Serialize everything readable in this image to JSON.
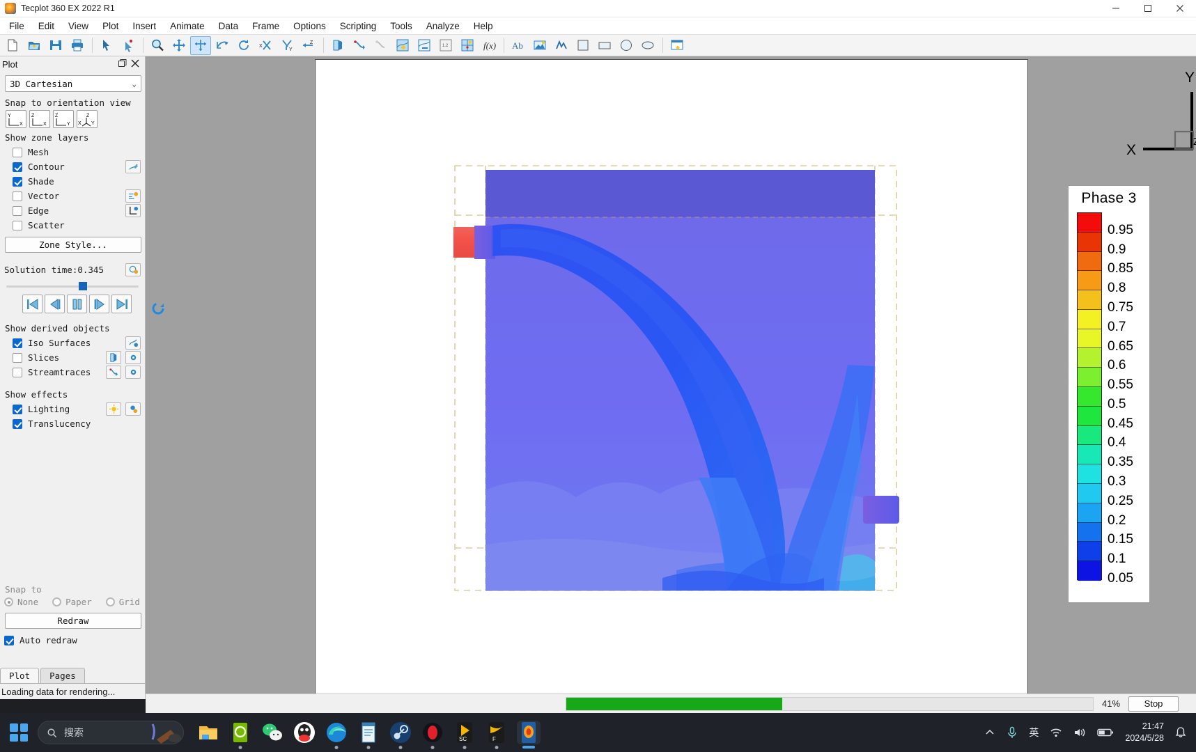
{
  "window": {
    "title": "Tecplot 360 EX 2022 R1",
    "app_icon": "tecplot-icon",
    "minimize_label": "Minimize",
    "maximize_label": "Maximize",
    "close_label": "Close"
  },
  "menubar": {
    "items": [
      {
        "label": "File"
      },
      {
        "label": "Edit"
      },
      {
        "label": "View"
      },
      {
        "label": "Plot"
      },
      {
        "label": "Insert"
      },
      {
        "label": "Animate"
      },
      {
        "label": "Data"
      },
      {
        "label": "Frame"
      },
      {
        "label": "Options"
      },
      {
        "label": "Scripting"
      },
      {
        "label": "Tools"
      },
      {
        "label": "Analyze"
      },
      {
        "label": "Help"
      }
    ]
  },
  "toolbar": {
    "buttons": [
      {
        "name": "new-layout-icon"
      },
      {
        "name": "open-layout-icon"
      },
      {
        "name": "save-layout-icon"
      },
      {
        "name": "print-icon"
      },
      {
        "name": "select-tool-icon"
      },
      {
        "name": "adjust-tool-icon"
      },
      {
        "name": "zoom-tool-icon"
      },
      {
        "name": "translate-tool-icon"
      },
      {
        "name": "rotate-spherical-icon"
      },
      {
        "name": "rotate-roller-icon"
      },
      {
        "name": "rotate-twist-icon"
      },
      {
        "name": "rotate-x-icon"
      },
      {
        "name": "rotate-y-icon"
      },
      {
        "name": "rotate-z-icon"
      },
      {
        "name": "slice-tool-icon"
      },
      {
        "name": "streamtrace-tool-icon"
      },
      {
        "name": "streamtrace-terminator-icon"
      },
      {
        "name": "contour-add-icon"
      },
      {
        "name": "contour-label-icon"
      },
      {
        "name": "value-label-icon"
      },
      {
        "name": "extract-points-icon"
      },
      {
        "name": "function-fx-icon"
      },
      {
        "name": "text-tool-icon"
      },
      {
        "name": "image-tool-icon"
      },
      {
        "name": "polyline-tool-icon"
      },
      {
        "name": "square-tool-icon"
      },
      {
        "name": "rectangle-tool-icon"
      },
      {
        "name": "circle-tool-icon"
      },
      {
        "name": "ellipse-tool-icon"
      },
      {
        "name": "new-frame-icon"
      }
    ]
  },
  "plot_panel": {
    "title": "Plot",
    "float_label": "Float",
    "close_label": "Close",
    "plot_type": "3D Cartesian",
    "orientation": {
      "label": "Snap to orientation view",
      "views": [
        {
          "name": "orientation-yx",
          "v": "Y",
          "h": "X"
        },
        {
          "name": "orientation-zx",
          "v": "Z",
          "h": "X"
        },
        {
          "name": "orientation-zy",
          "v": "Z",
          "h": "Y"
        },
        {
          "name": "orientation-xyz",
          "v": "Z",
          "h": "XY"
        }
      ]
    },
    "zone_layers": {
      "label": "Show zone layers",
      "items": [
        {
          "label": "Mesh",
          "checked": false,
          "side_buttons": []
        },
        {
          "label": "Contour",
          "checked": true,
          "side_buttons": [
            "contour-settings-icon"
          ]
        },
        {
          "label": "Shade",
          "checked": true,
          "side_buttons": []
        },
        {
          "label": "Vector",
          "checked": false,
          "side_buttons": [
            "vector-settings-icon"
          ]
        },
        {
          "label": "Edge",
          "checked": false,
          "side_buttons": [
            "edge-settings-icon"
          ]
        },
        {
          "label": "Scatter",
          "checked": false,
          "side_buttons": []
        }
      ],
      "zone_style_button": "Zone Style..."
    },
    "solution_time": {
      "label": "Solution time:",
      "value": "0.345",
      "settings_icon": "time-settings-icon",
      "transport": [
        {
          "name": "go-to-start-button"
        },
        {
          "name": "step-backward-button"
        },
        {
          "name": "pause-button"
        },
        {
          "name": "step-forward-button"
        },
        {
          "name": "go-to-end-button"
        }
      ]
    },
    "derived_objects": {
      "label": "Show derived objects",
      "items": [
        {
          "label": "Iso Surfaces",
          "checked": true,
          "side_buttons": [
            "iso-surface-settings-icon"
          ]
        },
        {
          "label": "Slices",
          "checked": false,
          "side_buttons": [
            "slice-tool-icon",
            "slice-settings-icon"
          ]
        },
        {
          "label": "Streamtraces",
          "checked": false,
          "side_buttons": [
            "streamtrace-tool-icon",
            "streamtrace-settings-icon"
          ]
        }
      ]
    },
    "effects": {
      "label": "Show effects",
      "items": [
        {
          "label": "Lighting",
          "checked": true,
          "side_buttons": [
            "lighting-tool-icon",
            "lighting-settings-icon"
          ]
        },
        {
          "label": "Translucency",
          "checked": true,
          "side_buttons": []
        }
      ]
    },
    "snap_to": {
      "label": "Snap to",
      "options": [
        {
          "label": "None",
          "selected": true
        },
        {
          "label": "Paper",
          "selected": false
        },
        {
          "label": "Grid",
          "selected": false
        }
      ]
    },
    "redraw_button": "Redraw",
    "auto_redraw": {
      "label": "Auto redraw",
      "checked": true
    },
    "tabs": [
      {
        "label": "Plot",
        "selected": true
      },
      {
        "label": "Pages",
        "selected": false
      }
    ]
  },
  "status": {
    "message": "Loading data for rendering...",
    "progress_percent": 41,
    "progress_label": "41%",
    "stop_button": "Stop"
  },
  "plot": {
    "axis_triad": {
      "x_label": "X",
      "y_label": "Y",
      "z_label": "Z"
    },
    "legend": {
      "title": "Phase 3",
      "labels": [
        "0.95",
        "0.9",
        "0.85",
        "0.8",
        "0.75",
        "0.7",
        "0.65",
        "0.6",
        "0.55",
        "0.5",
        "0.45",
        "0.4",
        "0.35",
        "0.3",
        "0.25",
        "0.2",
        "0.15",
        "0.1",
        "0.05"
      ],
      "colors_top_to_bottom": [
        "#f40b0b",
        "#e93405",
        "#f06a10",
        "#f79b17",
        "#f4c01c",
        "#f3f024",
        "#e8f526",
        "#b4f230",
        "#7cef2f",
        "#35e82e",
        "#1ee63f",
        "#18e87d",
        "#17e8b6",
        "#1ee2e2",
        "#1fc9f0",
        "#1ba4f2",
        "#1472ee",
        "#0f3fe8",
        "#0c13e2"
      ]
    },
    "simulation": {
      "description": "3D multiphase jet iso-surface in translucent tank",
      "inlet_color": "#ef4a44",
      "tank_color": "#6a66ee",
      "jet_color": "#2b52f0"
    }
  },
  "taskbar": {
    "search_placeholder": "搜索",
    "apps": [
      {
        "name": "file-explorer-icon"
      },
      {
        "name": "nvidia-app-icon"
      },
      {
        "name": "wechat-icon"
      },
      {
        "name": "qq-icon"
      },
      {
        "name": "edge-browser-icon"
      },
      {
        "name": "notepad-icon"
      },
      {
        "name": "steam-icon"
      },
      {
        "name": "recorder-icon"
      },
      {
        "name": "sc-app-icon"
      },
      {
        "name": "f-app-icon"
      },
      {
        "name": "tecplot-icon"
      }
    ],
    "tray": [
      {
        "name": "show-hidden-icons-chevron"
      },
      {
        "name": "microphone-icon"
      },
      {
        "name": "ime-language-indicator",
        "label": "英"
      },
      {
        "name": "wifi-icon"
      },
      {
        "name": "volume-icon"
      },
      {
        "name": "battery-icon"
      }
    ],
    "clock": {
      "time": "21:47",
      "date": "2024/5/28"
    },
    "notification_icon": "bell-icon"
  }
}
